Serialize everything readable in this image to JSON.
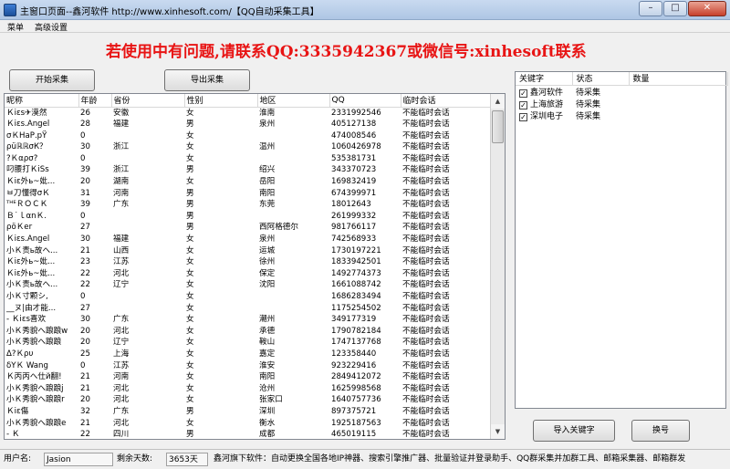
{
  "window": {
    "title": "主窗口页面--鑫河软件 http://www.xinhesoft.com/【QQ自动采集工具】"
  },
  "menu": [
    "菜单",
    "高级设置"
  ],
  "banner": "若使用中有问题,请联系QQ:3335942367或微信号:xinhesoft联系",
  "buttons": {
    "start": "开始采集",
    "export": "导出采集",
    "import_kw": "导入关键字",
    "switch": "换号"
  },
  "grid": {
    "columns": [
      "昵称",
      "年龄",
      "省份",
      "性别",
      "地区",
      "QQ",
      "临时会话"
    ],
    "rows": [
      [
        "Ｋiεs✈漠然",
        "26",
        "安徽",
        "女",
        "淮南",
        "2331992546",
        "不能临时会话"
      ],
      [
        "Ｋiεs.Angel",
        "28",
        "福建",
        "男",
        "泉州",
        "405127138",
        "不能临时会话"
      ],
      [
        "σＫНaР.pŸ",
        "0",
        "",
        "女",
        "",
        "474008546",
        "不能临时会话"
      ],
      [
        "ρüℝℝσК？",
        "30",
        "浙江",
        "女",
        "温州",
        "1060426978",
        "不能临时会话"
      ],
      [
        "?Ｋαρσ?",
        "0",
        "",
        "女",
        "",
        "535381731",
        "不能临时会话"
      ],
      [
        "叼腰打ＫiSs",
        "39",
        "浙江",
        "男",
        "绍兴",
        "343370723",
        "不能临时会话"
      ],
      [
        "Ｋiε外ь~妣...",
        "20",
        "湖南",
        "女",
        "岳阳",
        "169832419",
        "不能临时会话"
      ],
      [
        "ㅂ刀懂得σＫ",
        "31",
        "河南",
        "男",
        "南阳",
        "674399971",
        "不能临时会话"
      ],
      [
        "ᵀᴴᴱＲＯＣＫ",
        "39",
        "广东",
        "男",
        "东莞",
        "18012643",
        "不能临时会话"
      ],
      [
        "Ｂ˙ｌαnＫ.",
        "0",
        "",
        "男",
        "",
        "261999332",
        "不能临时会话"
      ],
      [
        "ρöＫer",
        "27",
        "",
        "男",
        "西阿格德尔",
        "981766117",
        "不能临时会话"
      ],
      [
        "Ｋiεs.Angel",
        "30",
        "福建",
        "女",
        "泉州",
        "742568933",
        "不能临时会话"
      ],
      [
        "小Ｋ责ь故へ...",
        "21",
        "山西",
        "女",
        "运城",
        "1730197221",
        "不能临时会话"
      ],
      [
        "Ｋiε外ь~妣...",
        "23",
        "江苏",
        "女",
        "徐州",
        "1833942501",
        "不能临时会话"
      ],
      [
        "Ｋiε外ь~妣...",
        "22",
        "河北",
        "女",
        "保定",
        "1492774373",
        "不能临时会话"
      ],
      [
        "小Ｋ责ь故へ...",
        "22",
        "辽宁",
        "女",
        "沈阳",
        "1661088742",
        "不能临时会话"
      ],
      [
        "小Ｋ寸颗シ,",
        "0",
        "",
        "女",
        "",
        "1686283494",
        "不能临时会话"
      ],
      [
        "__ヌ|由才能...",
        "27",
        "",
        "女",
        "",
        "1175254502",
        "不能临时会话"
      ],
      [
        "- Ｋiεs喜欢",
        "30",
        "广东",
        "女",
        "潮州",
        "349177319",
        "不能临时会话"
      ],
      [
        "小Ｋ秀貌へ踉踉w",
        "20",
        "河北",
        "女",
        "承德",
        "1790782184",
        "不能临时会话"
      ],
      [
        "小Ｋ秀貌へ踉踉",
        "20",
        "辽宁",
        "女",
        "鞍山",
        "1747137768",
        "不能临时会话"
      ],
      [
        "Δ?Ｋρυ",
        "25",
        "上海",
        "女",
        "嘉定",
        "123358440",
        "不能临时会话"
      ],
      [
        "δΥＫ Wang",
        "0",
        "江苏",
        "女",
        "淮安",
        "923229416",
        "不能临时会话"
      ],
      [
        "Ｋ丙丙へ仕й翻!",
        "21",
        "河南",
        "女",
        "南阳",
        "2849412072",
        "不能临时会话"
      ],
      [
        "小Ｋ秀貌へ踉踉j",
        "21",
        "河北",
        "女",
        "沧州",
        "1625998568",
        "不能临时会话"
      ],
      [
        "小Ｋ秀貌へ踉踉r",
        "20",
        "河北",
        "女",
        "张家口",
        "1640757736",
        "不能临时会话"
      ],
      [
        "Ｋiε傷",
        "32",
        "广东",
        "男",
        "深圳",
        "897375721",
        "不能临时会话"
      ],
      [
        "小Ｋ秀貌へ踉踉e",
        "21",
        "河北",
        "女",
        "衡水",
        "1925187563",
        "不能临时会话"
      ],
      [
        "- Ｋ",
        "22",
        "四川",
        "男",
        "成都",
        "465019115",
        "不能临时会话"
      ]
    ]
  },
  "keywords": {
    "columns": [
      "关键字",
      "状态",
      "数量"
    ],
    "rows": [
      {
        "checked": "✓",
        "name": "鑫河软件",
        "status": "待采集",
        "count": ""
      },
      {
        "checked": "✓",
        "name": "上海旅游",
        "status": "待采集",
        "count": ""
      },
      {
        "checked": "✓",
        "name": "深圳电子",
        "status": "待采集",
        "count": ""
      }
    ]
  },
  "status": {
    "user_label": "用户名:",
    "user": "Jasion",
    "days_label": "剩余天数:",
    "days": "3653天",
    "marquee": "鑫河旗下软件：自动更换全国各地IP神器、搜索引擎推广器、批量验证并登录助手、QQ群采集并加群工具、邮箱采集器、邮箱群发"
  }
}
